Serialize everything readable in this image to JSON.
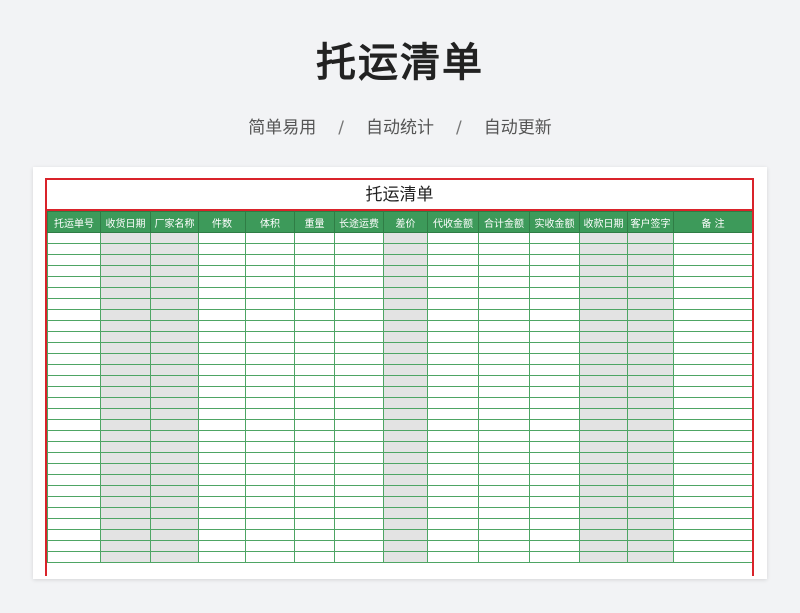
{
  "header": {
    "title": "托运清单",
    "taglines": [
      "简单易用",
      "自动统计",
      "自动更新"
    ],
    "separator": "/"
  },
  "sheet": {
    "title": "托运清单",
    "columns": [
      "托运单号",
      "收货日期",
      "厂家名称",
      "件数",
      "体积",
      "重量",
      "长途运费",
      "差价",
      "代收金额",
      "合计金额",
      "实收金额",
      "收款日期",
      "客户签字",
      "备  注"
    ],
    "shaded_columns": [
      1,
      2,
      7,
      11,
      12
    ],
    "empty_row_count": 30
  },
  "colors": {
    "header_green": "#3d9a5a",
    "grid_green": "#4ea564",
    "border_red": "#d9232a",
    "shade_gray": "#e3e3e3"
  }
}
